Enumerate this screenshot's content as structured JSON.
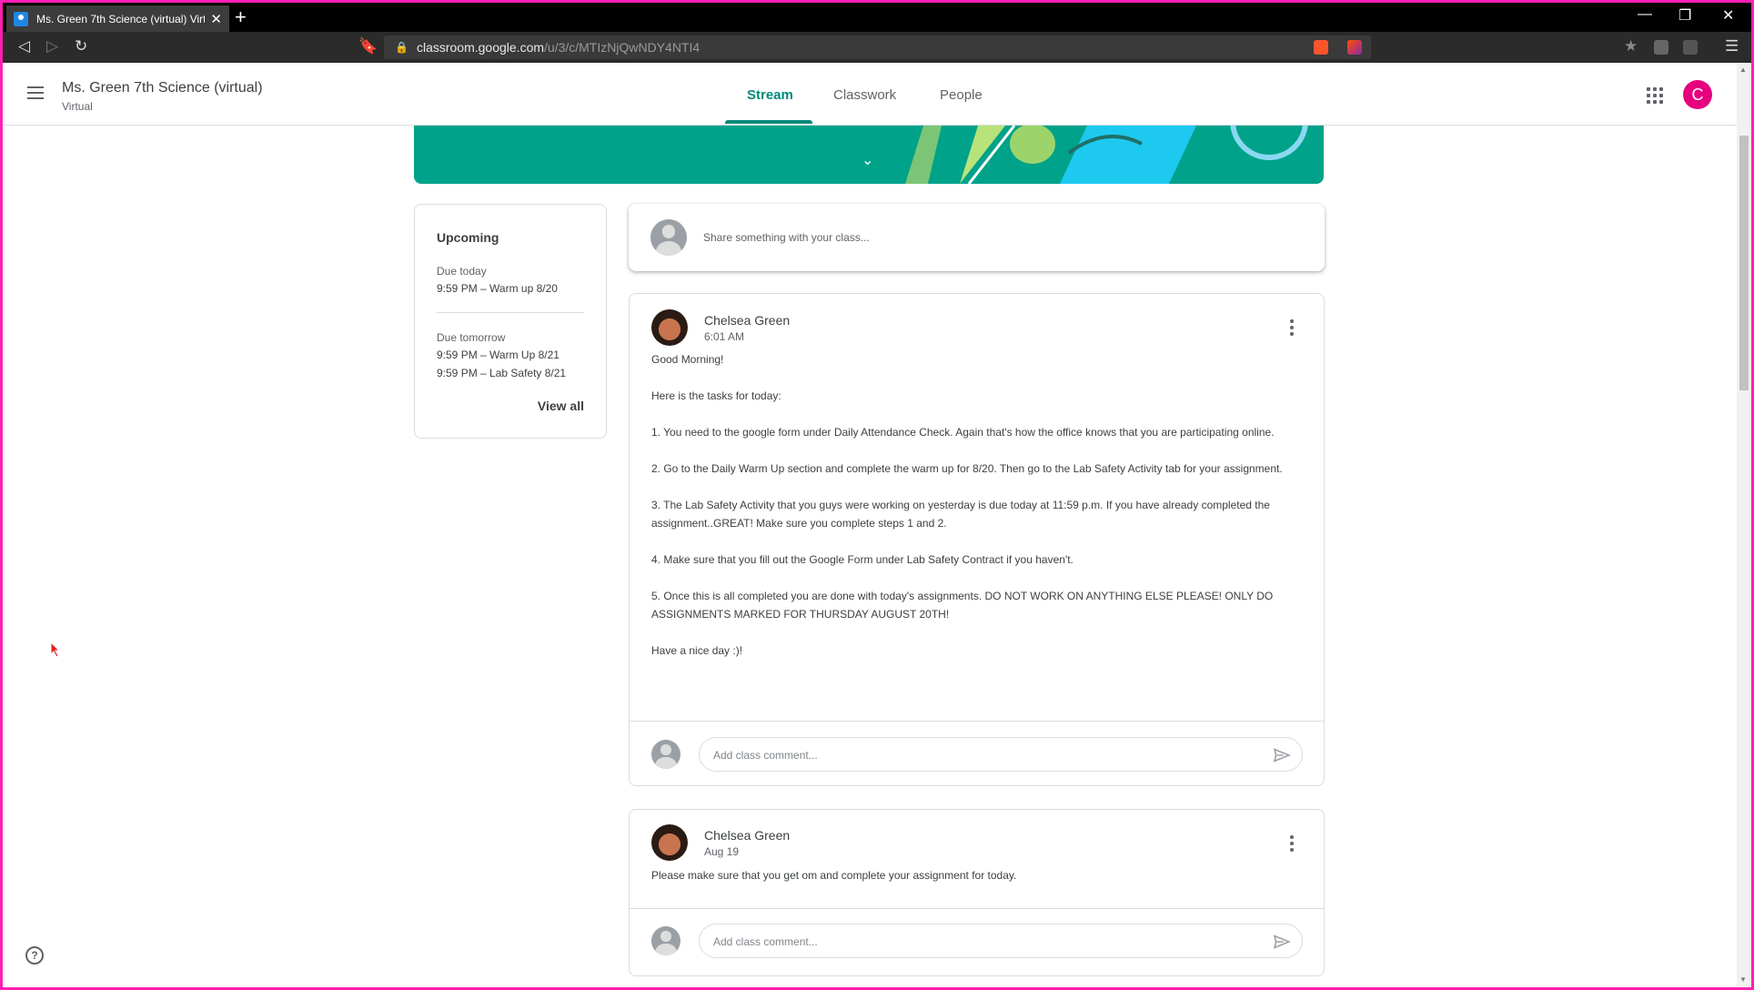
{
  "browser": {
    "tab_title": "Ms. Green 7th Science (virtual) Virt",
    "url_host": "classroom.google.com",
    "url_path": "/u/3/c/MTIzNjQwNDY4NTI4"
  },
  "header": {
    "class_name": "Ms. Green 7th Science (virtual)",
    "class_section": "Virtual",
    "tabs": [
      {
        "label": "Stream",
        "active": true
      },
      {
        "label": "Classwork",
        "active": false
      },
      {
        "label": "People",
        "active": false
      }
    ],
    "user_initial": "C"
  },
  "upcoming": {
    "title": "Upcoming",
    "groups": [
      {
        "due": "Due today",
        "items": [
          "9:59 PM – Warm up 8/20"
        ]
      },
      {
        "due": "Due tomorrow",
        "items": [
          "9:59 PM – Warm Up 8/21",
          "9:59 PM – Lab Safety 8/21"
        ]
      }
    ],
    "view_all": "View all"
  },
  "share": {
    "placeholder": "Share something with your class..."
  },
  "posts": [
    {
      "author": "Chelsea Green",
      "time": "6:01 AM",
      "paragraphs": [
        "Good Morning!",
        "Here is the tasks for today:",
        "1. You need to the google form under Daily Attendance Check. Again that's how the office knows that you are participating online.",
        "2. Go to the Daily Warm Up section and complete the warm up for 8/20. Then go to the Lab Safety Activity tab for your assignment.",
        "3. The Lab Safety Activity that you guys were working on yesterday is due today at 11:59 p.m. If you have already completed the assignment..GREAT! Make sure you complete steps 1 and 2.",
        "4. Make sure that you fill out the Google Form under Lab Safety Contract if you haven't.",
        "5.  Once this is all completed you are done with today's assignments. DO NOT WORK ON ANYTHING ELSE PLEASE! ONLY DO ASSIGNMENTS MARKED FOR THURSDAY AUGUST 20TH!",
        "Have a nice day :)!"
      ],
      "comment_placeholder": "Add class comment..."
    },
    {
      "author": "Chelsea Green",
      "time": "Aug 19",
      "paragraphs": [
        "Please make sure that you get om and complete your assignment for today."
      ],
      "comment_placeholder": "Add class comment..."
    }
  ],
  "help": {
    "symbol": "?"
  },
  "colors": {
    "accent": "#00897b",
    "banner": "#00a28a",
    "avatar": "#e6007e"
  }
}
